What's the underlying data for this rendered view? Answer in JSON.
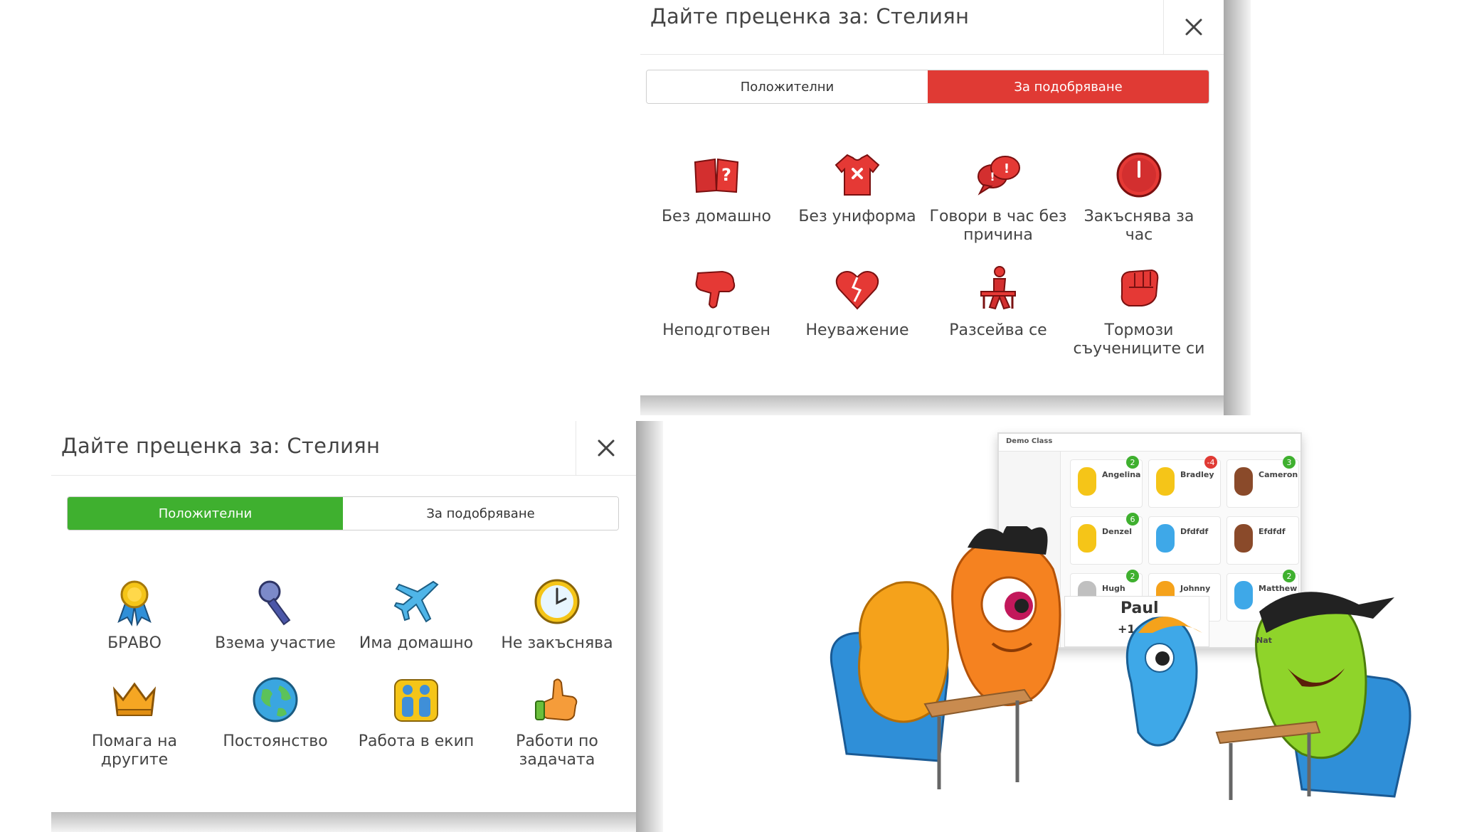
{
  "negative_dialog": {
    "title": "Дайте преценка за: Стелиян",
    "close_icon": "close-icon",
    "tabs": [
      "Положителни",
      "За подобряване"
    ],
    "active_tab": "За подобряване",
    "active_color": "#e03a34",
    "skills": [
      {
        "label": "Без домашно",
        "icon": "book-question-icon"
      },
      {
        "label": "Без униформа",
        "icon": "shirt-x-icon"
      },
      {
        "label": "Говори в час без причина",
        "icon": "speech-bubbles-icon"
      },
      {
        "label": "Закъснява за час",
        "icon": "clock-icon"
      },
      {
        "label": "Неподготвен",
        "icon": "thumbs-down-icon"
      },
      {
        "label": "Неуважение",
        "icon": "broken-heart-icon"
      },
      {
        "label": "Разсейва се",
        "icon": "distracted-person-icon"
      },
      {
        "label": "Тормози съучениците си",
        "icon": "fist-icon"
      }
    ]
  },
  "positive_dialog": {
    "title": "Дайте преценка за: Стелиян",
    "close_icon": "close-icon",
    "tabs": [
      "Положителни",
      "За подобряване"
    ],
    "active_tab": "Положителни",
    "active_color": "#3fb02f",
    "skills": [
      {
        "label": "БРАВО",
        "icon": "ribbon-medal-icon"
      },
      {
        "label": "Взема участие",
        "icon": "microphone-icon"
      },
      {
        "label": "Има домашно",
        "icon": "airplane-icon"
      },
      {
        "label": "Не закъснява",
        "icon": "clock-icon"
      },
      {
        "label": "Помага на другите",
        "icon": "crown-icon"
      },
      {
        "label": "Постоянство",
        "icon": "globe-icon"
      },
      {
        "label": "Работа в екип",
        "icon": "team-icon"
      },
      {
        "label": "Работи по задачата",
        "icon": "thumbs-up-icon"
      }
    ]
  },
  "illustration": {
    "class_name": "Demo Class",
    "students": [
      {
        "name": "Angelina",
        "badge": "2"
      },
      {
        "name": "Bradley",
        "badge": "-4"
      },
      {
        "name": "Cameron",
        "badge": "3"
      },
      {
        "name": "Denzel",
        "badge": "6"
      },
      {
        "name": "Dfdfdf",
        "badge": ""
      },
      {
        "name": "Efdfdf",
        "badge": ""
      },
      {
        "name": "Hugh",
        "badge": "2"
      },
      {
        "name": "Johnny",
        "badge": ""
      },
      {
        "name": "Matthew",
        "badge": "2"
      }
    ],
    "popup_name": "Paul",
    "popup_points": "+1 f",
    "partial_label": "Nat"
  }
}
